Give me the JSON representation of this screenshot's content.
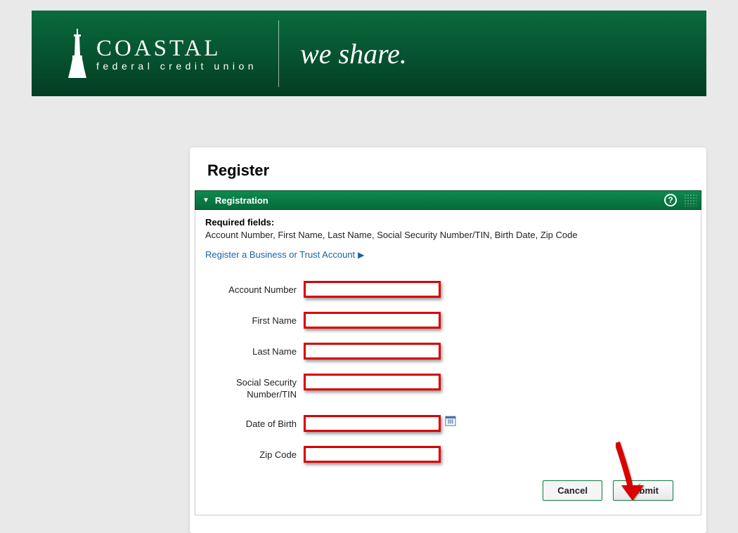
{
  "header": {
    "brand_main": "COASTAL",
    "brand_sub": "federal credit union",
    "tagline": "we share."
  },
  "card": {
    "title": "Register",
    "section_label": "Registration",
    "required_title": "Required fields:",
    "required_list": "Account Number, First Name, Last Name, Social Security Number/TIN, Birth Date, Zip Code",
    "business_link": "Register a Business or Trust Account"
  },
  "form": {
    "account_number": {
      "label": "Account Number",
      "value": ""
    },
    "first_name": {
      "label": "First Name",
      "value": ""
    },
    "last_name": {
      "label": "Last Name",
      "value": ""
    },
    "ssn": {
      "label": "Social Security Number/TIN",
      "value": ""
    },
    "dob": {
      "label": "Date of Birth",
      "value": ""
    },
    "zip": {
      "label": "Zip Code",
      "value": ""
    }
  },
  "buttons": {
    "cancel": "Cancel",
    "submit": "Submit"
  }
}
